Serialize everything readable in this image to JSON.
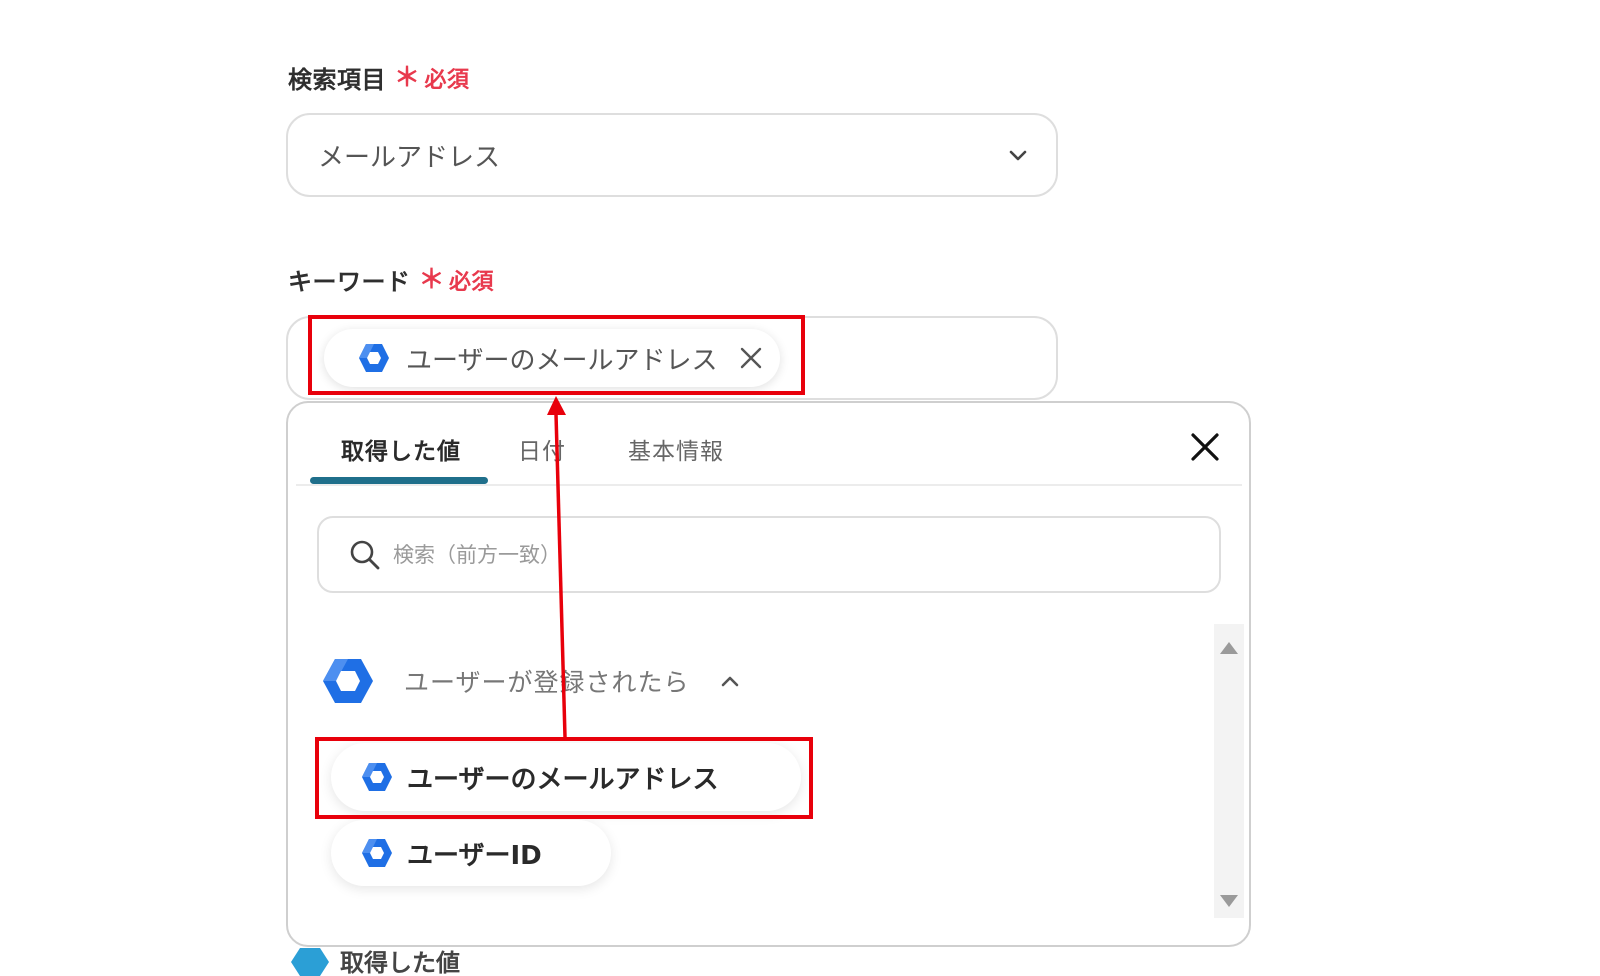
{
  "search_field": {
    "label": "検索項目",
    "required_star": "＊",
    "required_text": "必須",
    "selected_value": "メールアドレス"
  },
  "keyword_field": {
    "label": "キーワード",
    "required_star": "＊",
    "required_text": "必須",
    "chip_label": "ユーザーのメールアドレス"
  },
  "picker": {
    "tabs": [
      {
        "label": "取得した値",
        "active": true
      },
      {
        "label": "日付",
        "active": false
      },
      {
        "label": "基本情報",
        "active": false
      }
    ],
    "search_placeholder": "検索（前方一致）",
    "group_label": "ユーザーが登録されたら",
    "items": [
      {
        "label": "ユーザーのメールアドレス"
      },
      {
        "label": "ユーザーID"
      }
    ],
    "next_group_partial": "取得した値"
  },
  "colors": {
    "accent_tab": "#1f6f8b",
    "required": "#e8394d",
    "annotation": "#e8000b",
    "app_icon_blue": "#1f6fe5"
  },
  "icons": {
    "app": "google-workspace-hexagon-icon",
    "chevron_down": "chevron-down-icon",
    "chevron_up": "chevron-up-icon",
    "close": "close-icon",
    "search": "search-icon",
    "scroll_up": "scroll-up-arrow-icon",
    "scroll_down": "scroll-down-arrow-icon"
  }
}
